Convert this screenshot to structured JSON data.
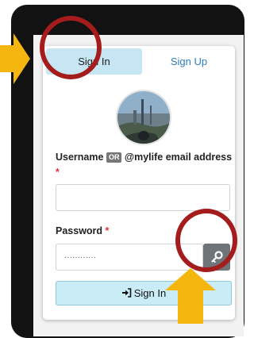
{
  "tabs": {
    "sign_in": "Sign In",
    "sign_up": "Sign Up"
  },
  "username": {
    "label_prefix": "Username",
    "or_badge": "OR",
    "label_suffix": "@mylife email address",
    "required_mark": "*",
    "value": ""
  },
  "password": {
    "label": "Password",
    "required_mark": "*",
    "value": "············"
  },
  "sign_in_button": {
    "label": "Sign In",
    "icon": "sign-in-icon"
  },
  "key_button": {
    "icon": "key-icon"
  },
  "annotations": {
    "circle_color": "#a51c1c",
    "arrow_color": "#f5b60f"
  }
}
